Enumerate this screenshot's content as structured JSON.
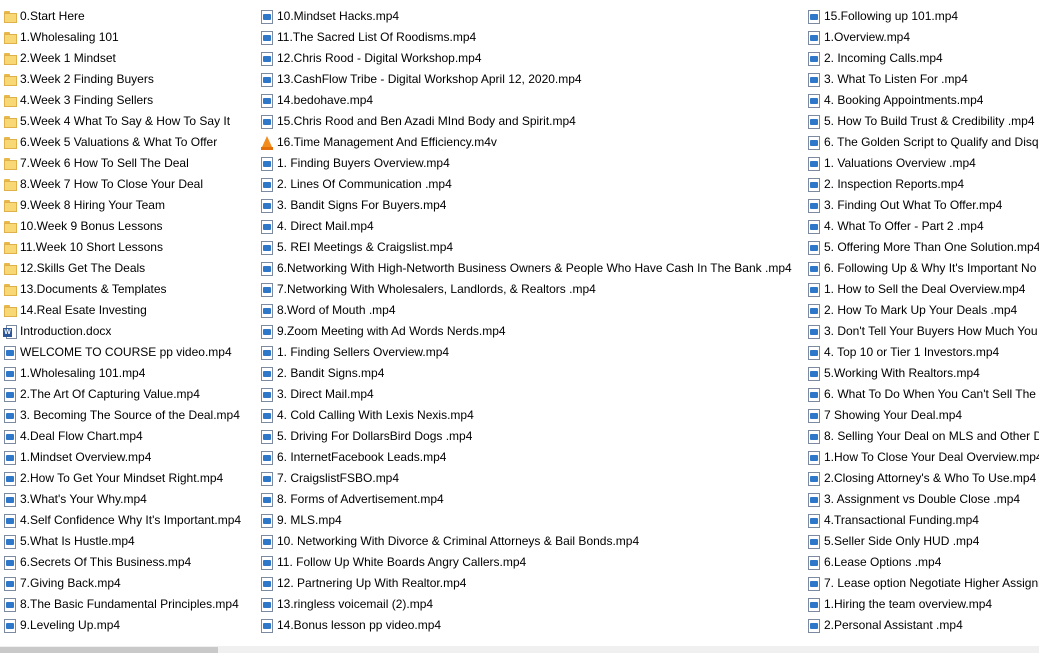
{
  "columns": [
    {
      "items": [
        {
          "label": "0.Start Here",
          "icon": "folder-icon"
        },
        {
          "label": "1.Wholesaling 101",
          "icon": "folder-icon"
        },
        {
          "label": "2.Week 1 Mindset",
          "icon": "folder-icon"
        },
        {
          "label": "3.Week 2 Finding Buyers",
          "icon": "folder-icon"
        },
        {
          "label": "4.Week 3 Finding Sellers",
          "icon": "folder-icon"
        },
        {
          "label": "5.Week 4 What To Say & How To Say It",
          "icon": "folder-icon"
        },
        {
          "label": "6.Week 5 Valuations & What To Offer",
          "icon": "folder-icon"
        },
        {
          "label": "7.Week 6 How To Sell The Deal",
          "icon": "folder-icon"
        },
        {
          "label": "8.Week 7 How To Close Your Deal",
          "icon": "folder-icon"
        },
        {
          "label": "9.Week 8 Hiring Your Team",
          "icon": "folder-icon"
        },
        {
          "label": "10.Week 9 Bonus Lessons",
          "icon": "folder-icon"
        },
        {
          "label": "11.Week 10 Short Lessons",
          "icon": "folder-icon"
        },
        {
          "label": "12.Skills Get The Deals",
          "icon": "folder-icon"
        },
        {
          "label": "13.Documents & Templates",
          "icon": "folder-icon"
        },
        {
          "label": "14.Real Esate Investing",
          "icon": "folder-icon"
        },
        {
          "label": "Introduction.docx",
          "icon": "word-document-icon"
        },
        {
          "label": "WELCOME TO COURSE pp video.mp4",
          "icon": "video-file-icon"
        },
        {
          "label": "1.Wholesaling 101.mp4",
          "icon": "video-file-icon"
        },
        {
          "label": "2.The Art Of Capturing Value.mp4",
          "icon": "video-file-icon"
        },
        {
          "label": "3. Becoming The Source of the Deal.mp4",
          "icon": "video-file-icon"
        },
        {
          "label": "4.Deal Flow Chart.mp4",
          "icon": "video-file-icon"
        },
        {
          "label": "1.Mindset Overview.mp4",
          "icon": "video-file-icon"
        },
        {
          "label": "2.How To Get Your Mindset Right.mp4",
          "icon": "video-file-icon"
        },
        {
          "label": "3.What's Your Why.mp4",
          "icon": "video-file-icon"
        },
        {
          "label": "4.Self Confidence Why It's Important.mp4",
          "icon": "video-file-icon"
        },
        {
          "label": "5.What Is Hustle.mp4",
          "icon": "video-file-icon"
        },
        {
          "label": "6.Secrets Of This Business.mp4",
          "icon": "video-file-icon"
        },
        {
          "label": "7.Giving Back.mp4",
          "icon": "video-file-icon"
        },
        {
          "label": "8.The Basic Fundamental Principles.mp4",
          "icon": "video-file-icon"
        },
        {
          "label": "9.Leveling Up.mp4",
          "icon": "video-file-icon"
        }
      ]
    },
    {
      "items": [
        {
          "label": "10.Mindset Hacks.mp4",
          "icon": "video-file-icon"
        },
        {
          "label": "11.The Sacred List Of Roodisms.mp4",
          "icon": "video-file-icon"
        },
        {
          "label": "12.Chris Rood - Digital Workshop.mp4",
          "icon": "video-file-icon"
        },
        {
          "label": "13.CashFlow Tribe - Digital Workshop April 12, 2020.mp4",
          "icon": "video-file-icon"
        },
        {
          "label": "14.bedohave.mp4",
          "icon": "video-file-icon"
        },
        {
          "label": "15.Chris Rood and Ben Azadi MInd Body and Spirit.mp4",
          "icon": "video-file-icon"
        },
        {
          "label": "16.Time Management And Efficiency.m4v",
          "icon": "vlc-media-icon"
        },
        {
          "label": "1. Finding Buyers Overview.mp4",
          "icon": "video-file-icon"
        },
        {
          "label": "2. Lines Of Communication .mp4",
          "icon": "video-file-icon"
        },
        {
          "label": "3. Bandit Signs For Buyers.mp4",
          "icon": "video-file-icon"
        },
        {
          "label": "4. Direct Mail.mp4",
          "icon": "video-file-icon"
        },
        {
          "label": "5. REI Meetings & Craigslist.mp4",
          "icon": "video-file-icon"
        },
        {
          "label": "6.Networking With High-Networth Business Owners & People Who Have Cash In The Bank .mp4",
          "icon": "video-file-icon"
        },
        {
          "label": "7.Networking With Wholesalers, Landlords, & Realtors .mp4",
          "icon": "video-file-icon"
        },
        {
          "label": "8.Word of Mouth .mp4",
          "icon": "video-file-icon"
        },
        {
          "label": "9.Zoom Meeting with Ad Words Nerds.mp4",
          "icon": "video-file-icon"
        },
        {
          "label": "1. Finding Sellers Overview.mp4",
          "icon": "video-file-icon"
        },
        {
          "label": "2. Bandit Signs.mp4",
          "icon": "video-file-icon"
        },
        {
          "label": "3. Direct Mail.mp4",
          "icon": "video-file-icon"
        },
        {
          "label": "4. Cold Calling With Lexis Nexis.mp4",
          "icon": "video-file-icon"
        },
        {
          "label": "5. Driving For DollarsBird Dogs .mp4",
          "icon": "video-file-icon"
        },
        {
          "label": "6. InternetFacebook Leads.mp4",
          "icon": "video-file-icon"
        },
        {
          "label": "7. CraigslistFSBO.mp4",
          "icon": "video-file-icon"
        },
        {
          "label": "8. Forms of Advertisement.mp4",
          "icon": "video-file-icon"
        },
        {
          "label": "9. MLS.mp4",
          "icon": "video-file-icon"
        },
        {
          "label": "10. Networking With Divorce & Criminal Attorneys & Bail Bonds.mp4",
          "icon": "video-file-icon"
        },
        {
          "label": "11. Follow Up  White Boards  Angry Callers.mp4",
          "icon": "video-file-icon"
        },
        {
          "label": "12. Partnering Up With Realtor.mp4",
          "icon": "video-file-icon"
        },
        {
          "label": "13.ringless voicemail (2).mp4",
          "icon": "video-file-icon"
        },
        {
          "label": "14.Bonus lesson pp video.mp4",
          "icon": "video-file-icon"
        }
      ]
    },
    {
      "items": [
        {
          "label": "15.Following up 101.mp4",
          "icon": "video-file-icon"
        },
        {
          "label": "1.Overview.mp4",
          "icon": "video-file-icon"
        },
        {
          "label": "2. Incoming Calls.mp4",
          "icon": "video-file-icon"
        },
        {
          "label": "3. What To Listen For .mp4",
          "icon": "video-file-icon"
        },
        {
          "label": "4. Booking Appointments.mp4",
          "icon": "video-file-icon"
        },
        {
          "label": "5. How To Build Trust & Credibility .mp4",
          "icon": "video-file-icon"
        },
        {
          "label": "6. The Golden Script to Qualify and Disqu",
          "icon": "video-file-icon"
        },
        {
          "label": "1. Valuations Overview .mp4",
          "icon": "video-file-icon"
        },
        {
          "label": "2. Inspection Reports.mp4",
          "icon": "video-file-icon"
        },
        {
          "label": "3. Finding Out What To Offer.mp4",
          "icon": "video-file-icon"
        },
        {
          "label": "4. What To Offer - Part 2 .mp4",
          "icon": "video-file-icon"
        },
        {
          "label": "5. Offering More Than One Solution.mp4",
          "icon": "video-file-icon"
        },
        {
          "label": "6. Following Up & Why It's Important No",
          "icon": "video-file-icon"
        },
        {
          "label": "1. How to Sell the Deal Overview.mp4",
          "icon": "video-file-icon"
        },
        {
          "label": "2. How To Mark Up Your Deals .mp4",
          "icon": "video-file-icon"
        },
        {
          "label": "3. Don't Tell Your Buyers How Much You",
          "icon": "video-file-icon"
        },
        {
          "label": "4. Top 10 or Tier 1 Investors.mp4",
          "icon": "video-file-icon"
        },
        {
          "label": "5.Working With Realtors.mp4",
          "icon": "video-file-icon"
        },
        {
          "label": "6. What To Do When You Can't Sell The D",
          "icon": "video-file-icon"
        },
        {
          "label": "7  Showing Your Deal.mp4",
          "icon": "video-file-icon"
        },
        {
          "label": "8.  Selling Your Deal on MLS and Other Di",
          "icon": "video-file-icon"
        },
        {
          "label": "1.How To Close Your Deal Overview.mp4",
          "icon": "video-file-icon"
        },
        {
          "label": "2.Closing Attorney's & Who To Use.mp4",
          "icon": "video-file-icon"
        },
        {
          "label": "3. Assignment vs Double Close .mp4",
          "icon": "video-file-icon"
        },
        {
          "label": "4.Transactional Funding.mp4",
          "icon": "video-file-icon"
        },
        {
          "label": "5.Seller Side Only HUD .mp4",
          "icon": "video-file-icon"
        },
        {
          "label": "6.Lease Options .mp4",
          "icon": "video-file-icon"
        },
        {
          "label": "7. Lease option Negotiate Higher Assignm",
          "icon": "video-file-icon"
        },
        {
          "label": "1.Hiring the team overview.mp4",
          "icon": "video-file-icon"
        },
        {
          "label": "2.Personal Assistant .mp4",
          "icon": "video-file-icon"
        }
      ]
    }
  ],
  "scrollbar": {
    "position": 0.0
  }
}
